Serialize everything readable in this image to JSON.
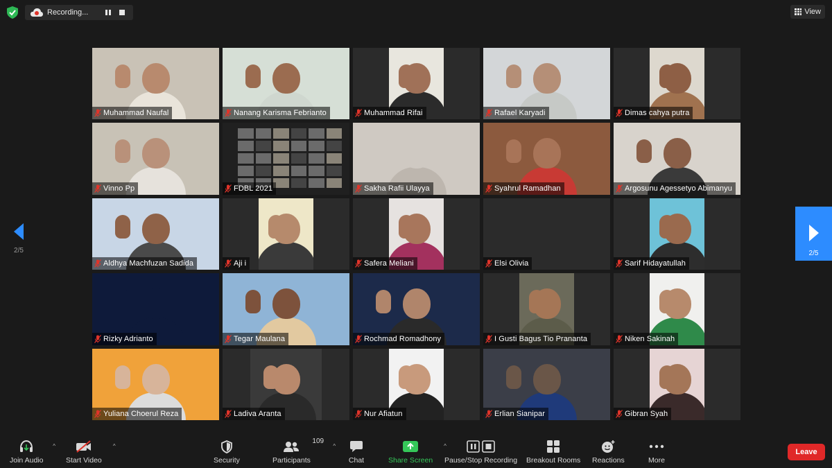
{
  "topbar": {
    "recording_label": "Recording...",
    "view_label": "View"
  },
  "pager": {
    "left_text": "2/5",
    "right_text": "2/5",
    "accent": "#2d8cff"
  },
  "participants": [
    {
      "name": "Muhammad Naufal",
      "bg": "#c9c2b6",
      "skin": "#b88a6e",
      "shirt": "#e9e4da",
      "layout": "full"
    },
    {
      "name": "Nanang Karisma Febrianto",
      "bg": "#d6dfd6",
      "skin": "#9b6c50",
      "shirt": "#cfd7cf",
      "layout": "full"
    },
    {
      "name": "Muhammad Rifai",
      "bg": "#e8e6de",
      "skin": "#a07158",
      "shirt": "#2b2b2b",
      "layout": "center"
    },
    {
      "name": "Rafael Karyadi",
      "bg": "#d3d6d8",
      "skin": "#b58f77",
      "shirt": "#c6c9c6",
      "layout": "full"
    },
    {
      "name": "Dimas cahya putra",
      "bg": "#ddd8ce",
      "skin": "#8e5f45",
      "shirt": "#a0724f",
      "layout": "center"
    },
    {
      "name": "Vinno Pp",
      "bg": "#c8c2b6",
      "skin": "#b9917a",
      "shirt": "#e6e2dc",
      "layout": "full"
    },
    {
      "name": "FDBL 2021",
      "bg": "#202020",
      "skin": "#202020",
      "shirt": "#202020",
      "layout": "screen"
    },
    {
      "name": "Sakha Rafii Ulayya",
      "bg": "#cfc9c2",
      "skin": "#cfc9c2",
      "shirt": "#bdb6ae",
      "layout": "full"
    },
    {
      "name": "Syahrul Ramadhan",
      "bg": "#8c5a3e",
      "skin": "#a87458",
      "shirt": "#c83a34",
      "layout": "full"
    },
    {
      "name": "Argosunu Agessetyo Abimanyu",
      "bg": "#d8d3cc",
      "skin": "#8a5f48",
      "shirt": "#3a3a3a",
      "layout": "full"
    },
    {
      "name": "Aldhya Machfuzan Sadida",
      "bg": "#c8d6e6",
      "skin": "#8f6248",
      "shirt": "#4a4a4a",
      "layout": "full"
    },
    {
      "name": "Aji i",
      "bg": "#eee7c8",
      "skin": "#b68a6c",
      "shirt": "#3a3a3a",
      "layout": "center"
    },
    {
      "name": "Safera Meliani",
      "bg": "#e6e2e0",
      "skin": "#a8765c",
      "shirt": "#a3315e",
      "layout": "center"
    },
    {
      "name": "Elsi Olivia",
      "bg": "#2b2b2b",
      "skin": "#2b2b2b",
      "shirt": "#2b2b2b",
      "layout": "empty"
    },
    {
      "name": "Sarif Hidayatullah",
      "bg": "#6ec2d8",
      "skin": "#9a6a4e",
      "shirt": "#2d2d2d",
      "layout": "center"
    },
    {
      "name": "Rizky Adrianto",
      "bg": "#0e1a3a",
      "skin": "#0e1a3a",
      "shirt": "#0e1a3a",
      "layout": "full"
    },
    {
      "name": "Tegar Maulana",
      "bg": "#8fb4d6",
      "skin": "#7d523c",
      "shirt": "#e2c9a0",
      "layout": "full"
    },
    {
      "name": "Rochmad Romadhony",
      "bg": "#1c2a4a",
      "skin": "#b0856b",
      "shirt": "#2a2a2a",
      "layout": "full"
    },
    {
      "name": "I Gusti Bagus Tio Prananta",
      "bg": "#6b6a5a",
      "skin": "#a57656",
      "shirt": "#5c5c4a",
      "layout": "center"
    },
    {
      "name": "Niken Sakinah",
      "bg": "#f0f0ee",
      "skin": "#b78a6c",
      "shirt": "#2f8a4a",
      "layout": "center"
    },
    {
      "name": "Yuliana Choerul Reza",
      "bg": "#f0a23a",
      "skin": "#d7b49a",
      "shirt": "#dcdcdc",
      "layout": "full"
    },
    {
      "name": "Ladiva Aranta",
      "bg": "#3a3a3a",
      "skin": "#b9896c",
      "shirt": "#2a2a2a",
      "layout": "centerwide"
    },
    {
      "name": "Nur Afiatun",
      "bg": "#f2f2f2",
      "skin": "#c89a7c",
      "shirt": "#222222",
      "layout": "center"
    },
    {
      "name": "Erlian Sianipar",
      "bg": "#3b3e48",
      "skin": "#6a5648",
      "shirt": "#1f3a7a",
      "layout": "full"
    },
    {
      "name": "Gibran Syah",
      "bg": "#e6d4d4",
      "skin": "#a47658",
      "shirt": "#3a2a2a",
      "layout": "center"
    }
  ],
  "toolbar": {
    "join_audio": "Join Audio",
    "start_video": "Start Video",
    "security": "Security",
    "participants": "Participants",
    "participants_count": "109",
    "chat": "Chat",
    "share_screen": "Share Screen",
    "pause_stop_recording": "Pause/Stop Recording",
    "breakout_rooms": "Breakout Rooms",
    "reactions": "Reactions",
    "more": "More",
    "leave": "Leave",
    "share_color": "#35c759",
    "leave_color": "#e02828"
  }
}
